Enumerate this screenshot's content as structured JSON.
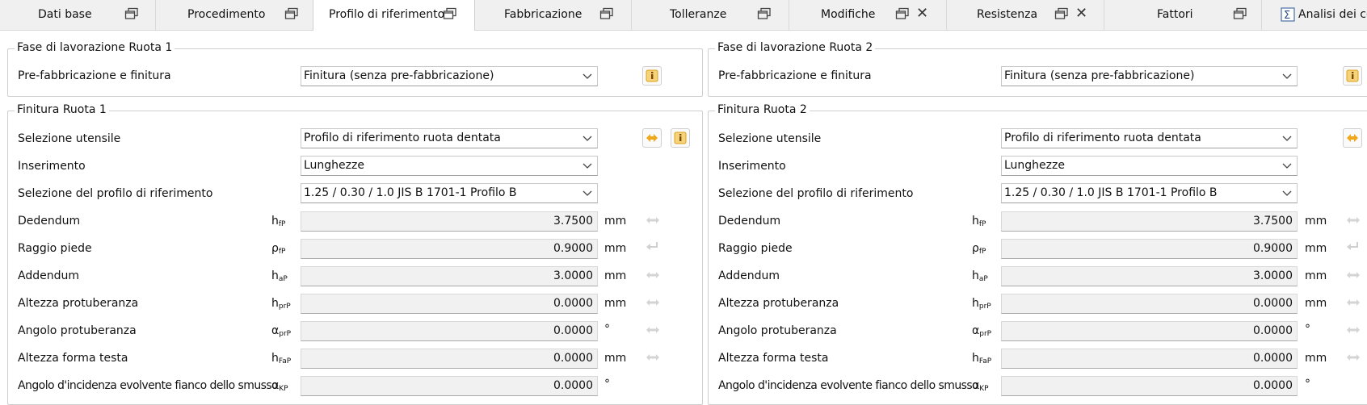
{
  "tabs": [
    {
      "label": "Dati base"
    },
    {
      "label": "Procedimento"
    },
    {
      "label": "Profilo di riferimento"
    },
    {
      "label": "Fabbricazione"
    },
    {
      "label": "Tolleranze"
    },
    {
      "label": "Modifiche"
    },
    {
      "label": "Resistenza"
    },
    {
      "label": "Fattori"
    },
    {
      "label": "Analisi dei con"
    }
  ],
  "wheel1": {
    "phase_title": "Fase di lavorazione Ruota 1",
    "pre_label": "Pre-fabbricazione e finitura",
    "pre_value": "Finitura (senza pre-fabbricazione)",
    "finish_title": "Finitura Ruota 1",
    "tool_label": "Selezione utensile",
    "tool_value": "Profilo di riferimento ruota dentata",
    "input_label": "Inserimento",
    "input_value": "Lunghezze",
    "profile_label": "Selezione del profilo di riferimento",
    "profile_value": "1.25 / 0.30 / 1.0 JIS B 1701-1 Profilo B",
    "rows": [
      {
        "label": "Dedendum",
        "sym": "h",
        "sub": "fP",
        "value": "3.7500",
        "unit": "mm"
      },
      {
        "label": "Raggio piede",
        "sym": "ρ",
        "sub": "fP",
        "value": "0.9000",
        "unit": "mm"
      },
      {
        "label": "Addendum",
        "sym": "h",
        "sub": "aP",
        "value": "3.0000",
        "unit": "mm"
      },
      {
        "label": "Altezza protuberanza",
        "sym": "h",
        "sub": "prP",
        "value": "0.0000",
        "unit": "mm"
      },
      {
        "label": "Angolo protuberanza",
        "sym": "α",
        "sub": "prP",
        "value": "0.0000",
        "unit": "°"
      },
      {
        "label": "Altezza forma testa",
        "sym": "h",
        "sub": "FaP",
        "value": "0.0000",
        "unit": "mm"
      },
      {
        "label": "Angolo d'incidenza evolvente fianco dello smusso",
        "sym": "α",
        "sub": "KP",
        "value": "0.0000",
        "unit": "°"
      }
    ]
  },
  "wheel2": {
    "phase_title": "Fase di lavorazione Ruota 2",
    "pre_label": "Pre-fabbricazione e finitura",
    "pre_value": "Finitura (senza pre-fabbricazione)",
    "finish_title": "Finitura Ruota 2",
    "tool_label": "Selezione utensile",
    "tool_value": "Profilo di riferimento ruota dentata",
    "input_label": "Inserimento",
    "input_value": "Lunghezze",
    "profile_label": "Selezione del profilo di riferimento",
    "profile_value": "1.25 / 0.30 / 1.0 JIS B 1701-1 Profilo B",
    "rows": [
      {
        "label": "Dedendum",
        "sym": "h",
        "sub": "fP",
        "value": "3.7500",
        "unit": "mm"
      },
      {
        "label": "Raggio piede",
        "sym": "ρ",
        "sub": "fP",
        "value": "0.9000",
        "unit": "mm"
      },
      {
        "label": "Addendum",
        "sym": "h",
        "sub": "aP",
        "value": "3.0000",
        "unit": "mm"
      },
      {
        "label": "Altezza protuberanza",
        "sym": "h",
        "sub": "prP",
        "value": "0.0000",
        "unit": "mm"
      },
      {
        "label": "Angolo protuberanza",
        "sym": "α",
        "sub": "prP",
        "value": "0.0000",
        "unit": "°"
      },
      {
        "label": "Altezza forma testa",
        "sym": "h",
        "sub": "FaP",
        "value": "0.0000",
        "unit": "mm"
      },
      {
        "label": "Angolo d'incidenza evolvente fianco dello smusso",
        "sym": "α",
        "sub": "KP",
        "value": "0.0000",
        "unit": "°"
      }
    ]
  },
  "colors": {
    "accent_orange": "#e8a317",
    "active_tab_bg": "#ffffff",
    "tabbar_bg": "#f0f0f0"
  }
}
